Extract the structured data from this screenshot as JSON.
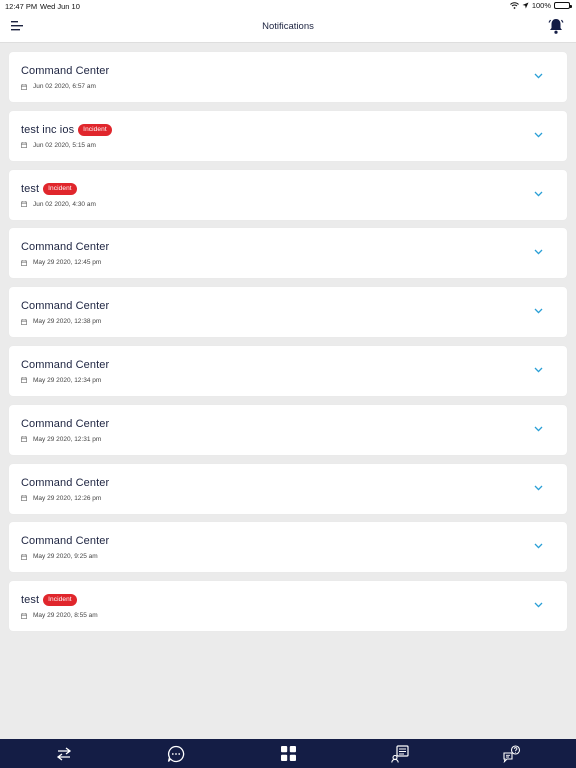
{
  "status": {
    "time": "12:47 PM",
    "date": "Wed Jun 10",
    "battery": "100%"
  },
  "header": {
    "title": "Notifications"
  },
  "notifications": [
    {
      "title": "Command Center",
      "badge": "",
      "datetime": "Jun 02 2020, 6:57 am"
    },
    {
      "title": "test inc ios",
      "badge": "Incident",
      "datetime": "Jun 02 2020, 5:15 am"
    },
    {
      "title": "test",
      "badge": "Incident",
      "datetime": "Jun 02 2020, 4:30 am"
    },
    {
      "title": "Command Center",
      "badge": "",
      "datetime": "May 29 2020, 12:45 pm"
    },
    {
      "title": "Command Center",
      "badge": "",
      "datetime": "May 29 2020, 12:38 pm"
    },
    {
      "title": "Command Center",
      "badge": "",
      "datetime": "May 29 2020, 12:34 pm"
    },
    {
      "title": "Command Center",
      "badge": "",
      "datetime": "May 29 2020, 12:31 pm"
    },
    {
      "title": "Command Center",
      "badge": "",
      "datetime": "May 29 2020, 12:26 pm"
    },
    {
      "title": "Command Center",
      "badge": "",
      "datetime": "May 29 2020, 9:25 am"
    },
    {
      "title": "test",
      "badge": "Incident",
      "datetime": "May 29 2020, 8:55 am"
    }
  ],
  "tabs": [
    {
      "icon": "swap-arrows-icon"
    },
    {
      "icon": "chat-bubble-icon"
    },
    {
      "icon": "grid-icon"
    },
    {
      "icon": "user-list-icon"
    },
    {
      "icon": "help-chat-icon"
    }
  ],
  "colors": {
    "accent": "#2a9fd6",
    "badge": "#e0262c",
    "tabbar": "#141d45",
    "text": "#1c2340"
  }
}
